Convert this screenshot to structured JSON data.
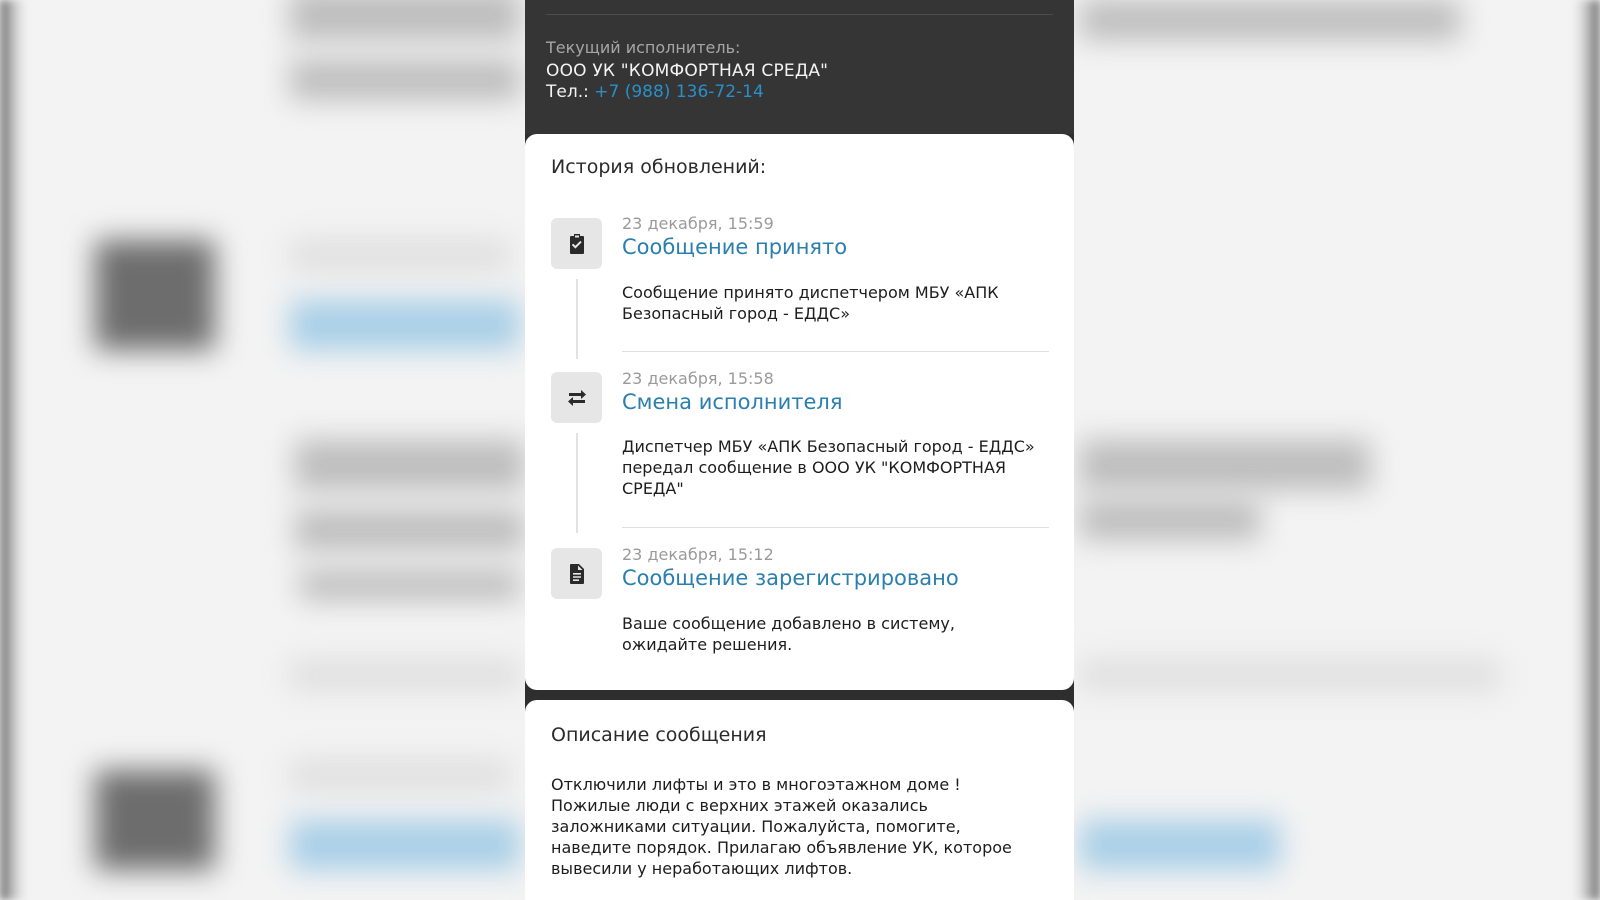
{
  "executor": {
    "label": "Текущий исполнитель:",
    "name": "ООО УК \"КОМФОРТНАЯ СРЕДА\"",
    "phone_prefix": "Тел.:",
    "phone": "+7 (988) 136-72-14"
  },
  "history": {
    "title": "История обновлений:",
    "events": [
      {
        "icon": "clipboard-check-icon",
        "date": "23 декабря, 15:59",
        "title": "Сообщение принято",
        "description": "Сообщение принято диспетчером МБУ «АПК Безопасный город - ЕДДС»"
      },
      {
        "icon": "swap-arrows-icon",
        "date": "23 декабря, 15:58",
        "title": "Смена исполнителя",
        "description": "Диспетчер МБУ «АПК Безопасный город - ЕДДС» передал сообщение в ООО УК \"КОМФОРТНАЯ СРЕДА\""
      },
      {
        "icon": "document-icon",
        "date": "23 декабря, 15:12",
        "title": "Сообщение зарегистрировано",
        "description": "Ваше сообщение добавлено в систему, ожидайте решения."
      }
    ]
  },
  "message": {
    "title": "Описание сообщения",
    "text": "Отключили лифты и это в многоэтажном доме ! Пожилые люди с верхних этажей оказались заложниками ситуации. Пожалуйста, помогите, наведите порядок. Прилагаю объявление УК, которое вывесили у неработающих лифтов."
  },
  "colors": {
    "link": "#2a8fc9",
    "title_blue": "#2a7fae",
    "dark_header": "#353535"
  }
}
